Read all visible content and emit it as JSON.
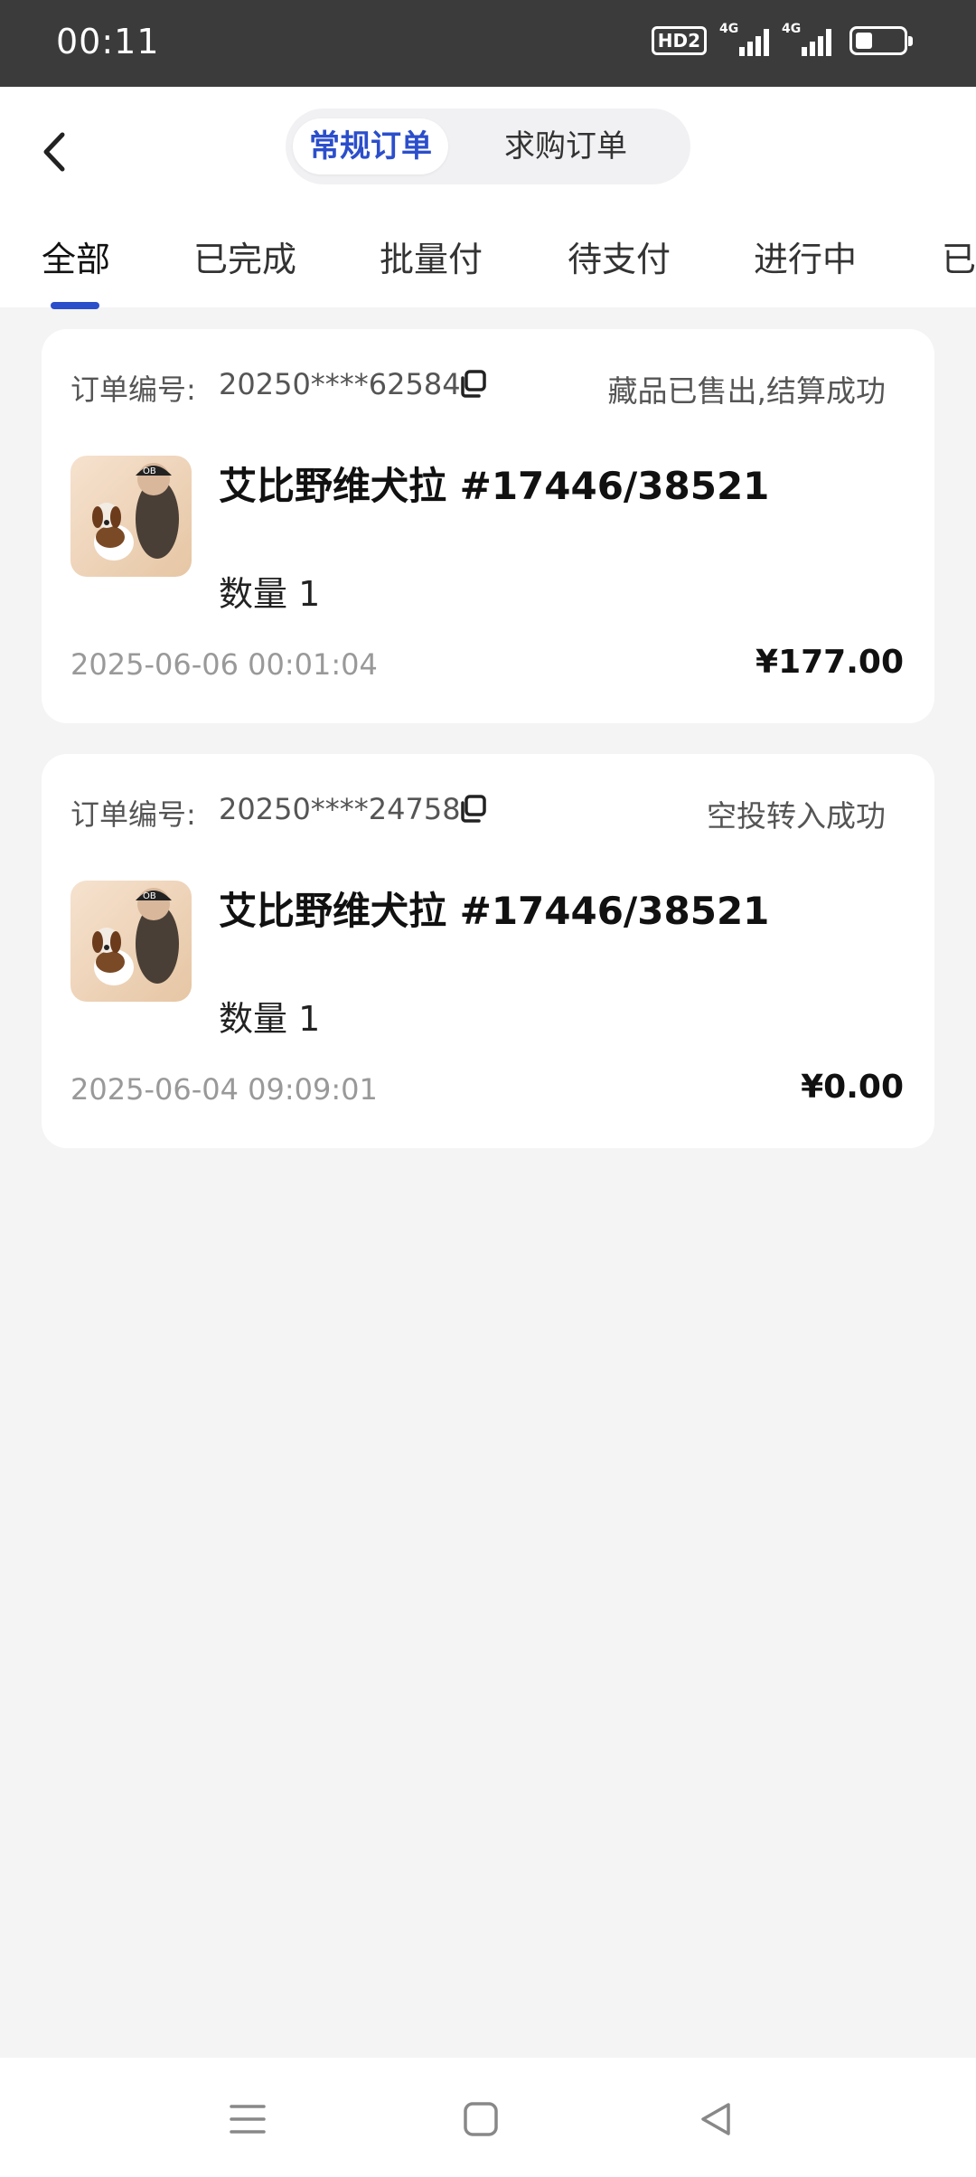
{
  "status_bar": {
    "time": "00:11",
    "hd_badge": "HD2",
    "network_1": "4G",
    "network_2": "4G",
    "battery_level": 0.35
  },
  "header": {
    "segments": [
      "常规订单",
      "求购订单"
    ],
    "active_segment": "常规订单"
  },
  "tabs": [
    "全部",
    "已完成",
    "批量付",
    "待支付",
    "进行中",
    "已"
  ],
  "active_tab": "全部",
  "orders": [
    {
      "order_label": "订单编号:",
      "order_no": "20250****62584",
      "status": "藏品已售出,结算成功",
      "title": "艾比野维犬拉  #17446/38521",
      "quantity": "数量 1",
      "date": "2025-06-06 00:01:04",
      "price": "¥177.00"
    },
    {
      "order_label": "订单编号:",
      "order_no": "20250****24758",
      "status": "空投转入成功",
      "title": "艾比野维犬拉  #17446/38521",
      "quantity": "数量 1",
      "date": "2025-06-04 09:09:01",
      "price": "¥0.00"
    }
  ],
  "colors": {
    "accent": "#2b4ecb",
    "background": "#f4f4f5",
    "status_bar": "#3b3b3b"
  },
  "icons": {
    "back": "chevron-left-icon",
    "copy": "copy-icon",
    "nav_menu": "menu-icon",
    "nav_home": "square-home-icon",
    "nav_back": "triangle-back-icon"
  }
}
